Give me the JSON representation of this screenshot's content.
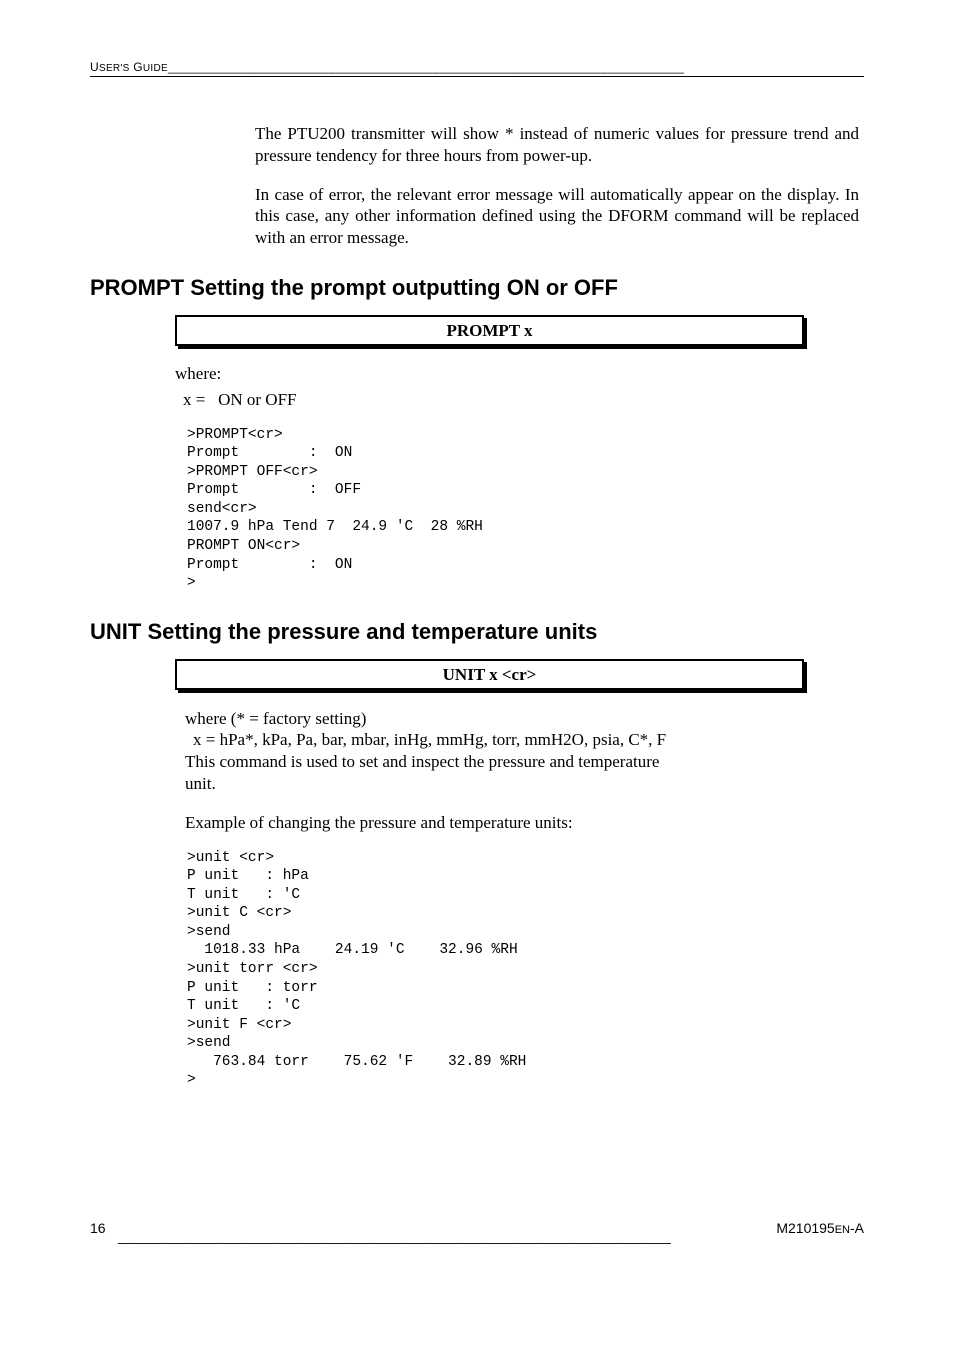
{
  "header": {
    "left": "User's Guide",
    "rule": "__________________________________________________________________________"
  },
  "para1": "The PTU200 transmitter will show * instead of numeric values for pressure trend and pressure tendency for three hours from power-up.",
  "para2": "In case of error, the relevant error message will automatically appear on the display. In this case, any other information defined using the DFORM command will be replaced with an error message.",
  "section1": {
    "title": "PROMPT Setting the prompt outputting ON or OFF",
    "box": "PROMPT x",
    "where_label": "where:",
    "x_label": "x =",
    "x_val": "ON or OFF",
    "code": ">PROMPT<cr>\nPrompt        :  ON\n>PROMPT OFF<cr>\nPrompt        :  OFF\nsend<cr>\n1007.9 hPa Tend 7  24.9 'C  28 %RH\nPROMPT ON<cr>\nPrompt        :  ON\n>"
  },
  "section2": {
    "title": "UNIT Setting the pressure and temperature units",
    "box": "UNIT x <cr>",
    "where_line": "where    (* = factory setting)",
    "x_line": "x  = hPa*, kPa, Pa, bar, mbar, inHg, mmHg, torr, mmH2O, psia, C*, F",
    "desc": "This command is used to set and inspect the pressure and temperature unit.",
    "example_label": "Example of changing the pressure and temperature units:",
    "code": ">unit <cr>\nP unit   : hPa\nT unit   : 'C\n>unit C <cr>\n>send\n  1018.33 hPa    24.19 'C    32.96 %RH\n>unit torr <cr>\nP unit   : torr\nT unit   : 'C\n>unit F <cr>\n>send\n   763.84 torr    75.62 'F    32.89 %RH\n>"
  },
  "footer": {
    "page": "16",
    "rule": "_______________________________________________________________________",
    "doc_prefix": "M210195",
    "doc_small": "en",
    "doc_suffix": "-A"
  }
}
